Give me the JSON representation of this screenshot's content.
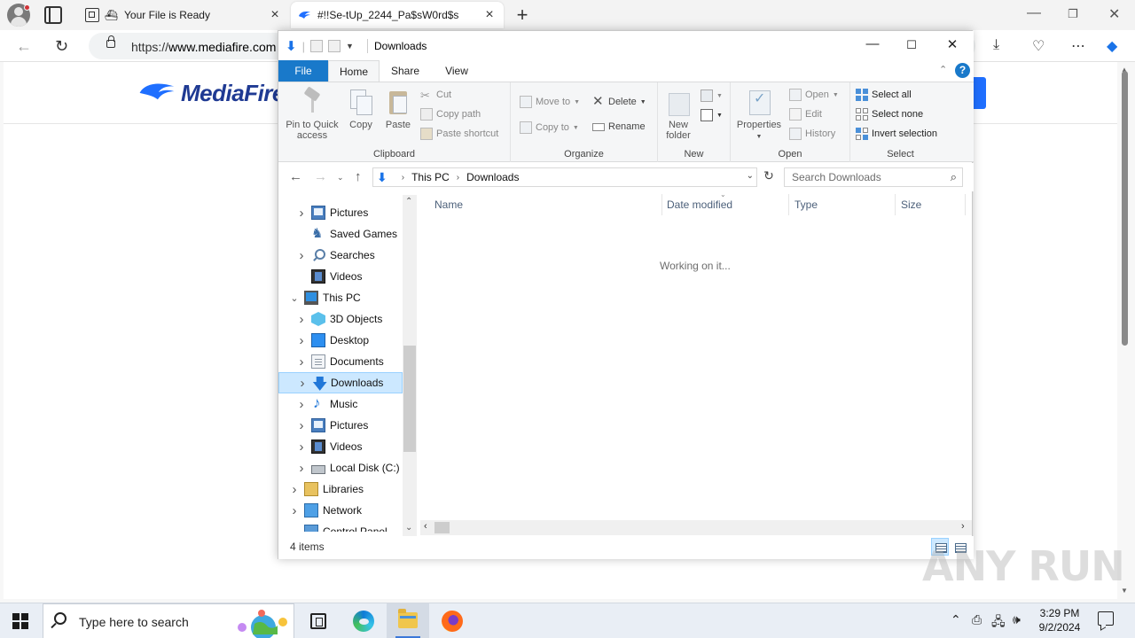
{
  "browser": {
    "tabs": [
      {
        "title": "Your File is Ready",
        "active": false
      },
      {
        "title": "#!!Se-tUp_2244_Pa$sW0rd$s",
        "active": true
      }
    ],
    "url_prefix": "https://",
    "url_domain": "www.mediafire.com"
  },
  "page": {
    "logo_text": "MediaFire"
  },
  "explorer": {
    "title": "Downloads",
    "ribbon_tabs": [
      "File",
      "Home",
      "Share",
      "View"
    ],
    "help_label": "?",
    "clipboard": {
      "pin_line1": "Pin to Quick",
      "pin_line2": "access",
      "copy": "Copy",
      "paste": "Paste",
      "cut": "Cut",
      "copy_path": "Copy path",
      "paste_shortcut": "Paste shortcut",
      "group": "Clipboard"
    },
    "organize": {
      "move_to": "Move to",
      "copy_to": "Copy to",
      "delete": "Delete",
      "rename": "Rename",
      "group": "Organize"
    },
    "new": {
      "new_folder_line1": "New",
      "new_folder_line2": "folder",
      "group": "New"
    },
    "open": {
      "properties": "Properties",
      "open": "Open",
      "edit": "Edit",
      "history": "History",
      "group": "Open"
    },
    "select": {
      "select_all": "Select all",
      "select_none": "Select none",
      "invert_selection": "Invert selection",
      "group": "Select"
    },
    "address": {
      "crumbs": [
        "This PC",
        "Downloads"
      ],
      "search_placeholder": "Search Downloads"
    },
    "tree": [
      {
        "label": "Pictures",
        "icon": "pictures-icon",
        "indent": 1,
        "chevron": "right"
      },
      {
        "label": "Saved Games",
        "icon": "saved-games-icon",
        "indent": 1,
        "chevron": "none"
      },
      {
        "label": "Searches",
        "icon": "searches-icon",
        "indent": 1,
        "chevron": "right"
      },
      {
        "label": "Videos",
        "icon": "videos-icon",
        "indent": 1,
        "chevron": "none"
      },
      {
        "label": "This PC",
        "icon": "this-pc-icon",
        "indent": 0,
        "chevron": "down"
      },
      {
        "label": "3D Objects",
        "icon": "3d-objects-icon",
        "indent": 1,
        "chevron": "right"
      },
      {
        "label": "Desktop",
        "icon": "desktop-icon",
        "indent": 1,
        "chevron": "right"
      },
      {
        "label": "Documents",
        "icon": "documents-icon",
        "indent": 1,
        "chevron": "right"
      },
      {
        "label": "Downloads",
        "icon": "downloads-icon",
        "indent": 1,
        "chevron": "right",
        "selected": true
      },
      {
        "label": "Music",
        "icon": "music-icon",
        "indent": 1,
        "chevron": "right"
      },
      {
        "label": "Pictures",
        "icon": "pictures-icon",
        "indent": 1,
        "chevron": "right"
      },
      {
        "label": "Videos",
        "icon": "videos-icon",
        "indent": 1,
        "chevron": "right"
      },
      {
        "label": "Local Disk (C:)",
        "icon": "local-disk-icon",
        "indent": 1,
        "chevron": "right"
      },
      {
        "label": "Libraries",
        "icon": "libraries-icon",
        "indent": 0,
        "chevron": "right"
      },
      {
        "label": "Network",
        "icon": "network-icon",
        "indent": 0,
        "chevron": "right"
      },
      {
        "label": "Control Panel",
        "icon": "control-panel-icon",
        "indent": 0,
        "chevron": "down"
      }
    ],
    "columns": [
      "Name",
      "Date modified",
      "Type",
      "Size"
    ],
    "working_text": "Working on it...",
    "status": "4 items"
  },
  "watermark": "ANY RUN",
  "taskbar": {
    "search_placeholder": "Type here to search",
    "time": "3:29 PM",
    "date": "9/2/2024"
  },
  "colors": {
    "accent": "#1979ca",
    "selection": "#cce8ff",
    "mediafire_blue": "#1f3a93"
  }
}
